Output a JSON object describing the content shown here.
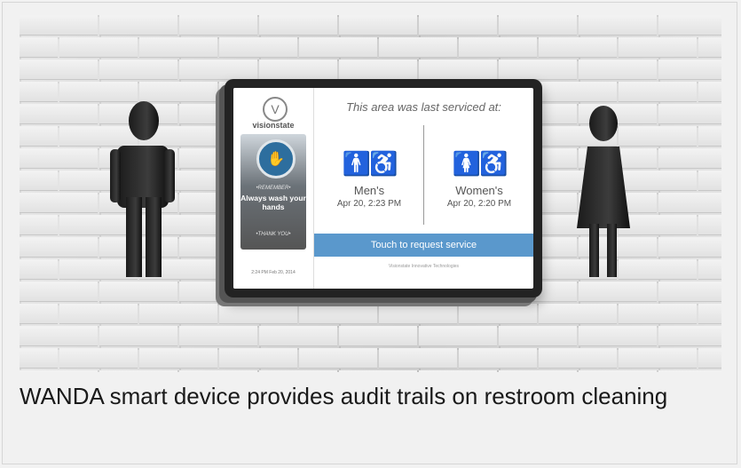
{
  "caption": "WANDA smart device provides audit trails on restroom cleaning",
  "screen": {
    "brand": "visionstate",
    "logo_letter": "V",
    "poster": {
      "remember": "•REMEMBER•",
      "message": "Always wash your hands",
      "thank_you": "•THANK YOU•"
    },
    "timestamp": "2:24 PM Feb 20, 2014",
    "heading": "This area was last serviced at:",
    "men": {
      "label": "Men's",
      "time": "Apr 20, 2:23 PM"
    },
    "women": {
      "label": "Women's",
      "time": "Apr 20, 2:20 PM"
    },
    "request_button": "Touch to request service",
    "footer": "Visionstate Innovative Technologies"
  },
  "colors": {
    "request_button": "#5a98cc",
    "hand_badge": "#2d6e9e"
  },
  "icons": [
    "male-restroom-icon",
    "female-restroom-icon",
    "wheelchair-icon",
    "handwash-icon"
  ]
}
